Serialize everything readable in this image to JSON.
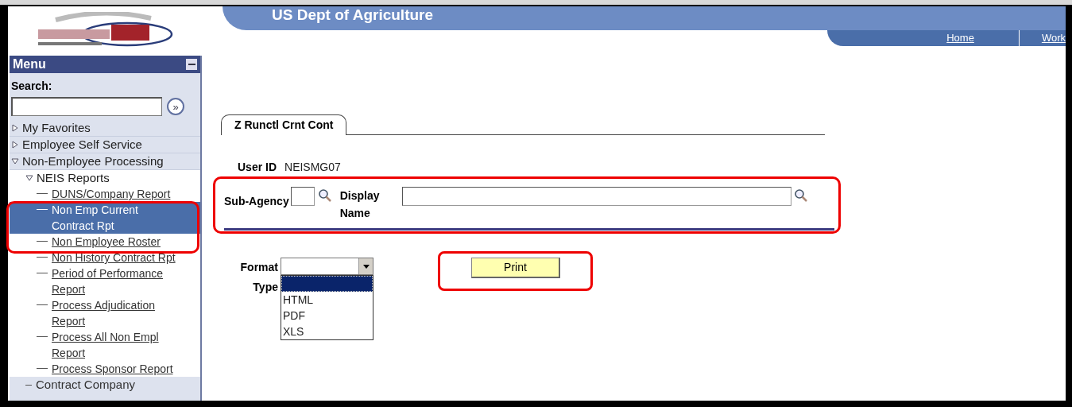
{
  "header": {
    "title": "US Dept of Agriculture",
    "links": [
      "Home",
      "Work"
    ]
  },
  "sidebar": {
    "title": "Menu",
    "search_label": "Search:",
    "search_button": "»",
    "items": [
      {
        "label": "My Favorites",
        "expanded": false
      },
      {
        "label": "Employee Self Service",
        "expanded": false
      },
      {
        "label": "Non-Employee Processing",
        "expanded": true,
        "children": [
          {
            "label": "NEIS Reports",
            "expanded": true,
            "children": [
              {
                "label": "DUNS/Company Report",
                "selected": false
              },
              {
                "label": "Non Emp Current Contract Rpt",
                "selected": true
              },
              {
                "label": "Non Employee Roster",
                "selected": false
              },
              {
                "label": "Non History Contract Rpt",
                "selected": false
              },
              {
                "label": "Period of Performance Report",
                "selected": false
              },
              {
                "label": "Process Adjudication Report",
                "selected": false
              },
              {
                "label": "Process All Non Empl Report",
                "selected": false
              },
              {
                "label": "Process Sponsor Report",
                "selected": false
              }
            ]
          },
          {
            "label": "Contract Company"
          }
        ]
      }
    ]
  },
  "tab": {
    "label": "Z Runctl Crnt Cont"
  },
  "form": {
    "user_id_label": "User ID",
    "user_id": "NEISMG07",
    "sub_agency_label": "Sub-Agency",
    "display_name_label": "Display Name",
    "format_label": "Format Type",
    "format_options": [
      {
        "label": "HTML",
        "selected": false
      },
      {
        "label": "PDF",
        "selected": false
      },
      {
        "label": "XLS",
        "selected": false
      }
    ],
    "print_button": "Print"
  }
}
